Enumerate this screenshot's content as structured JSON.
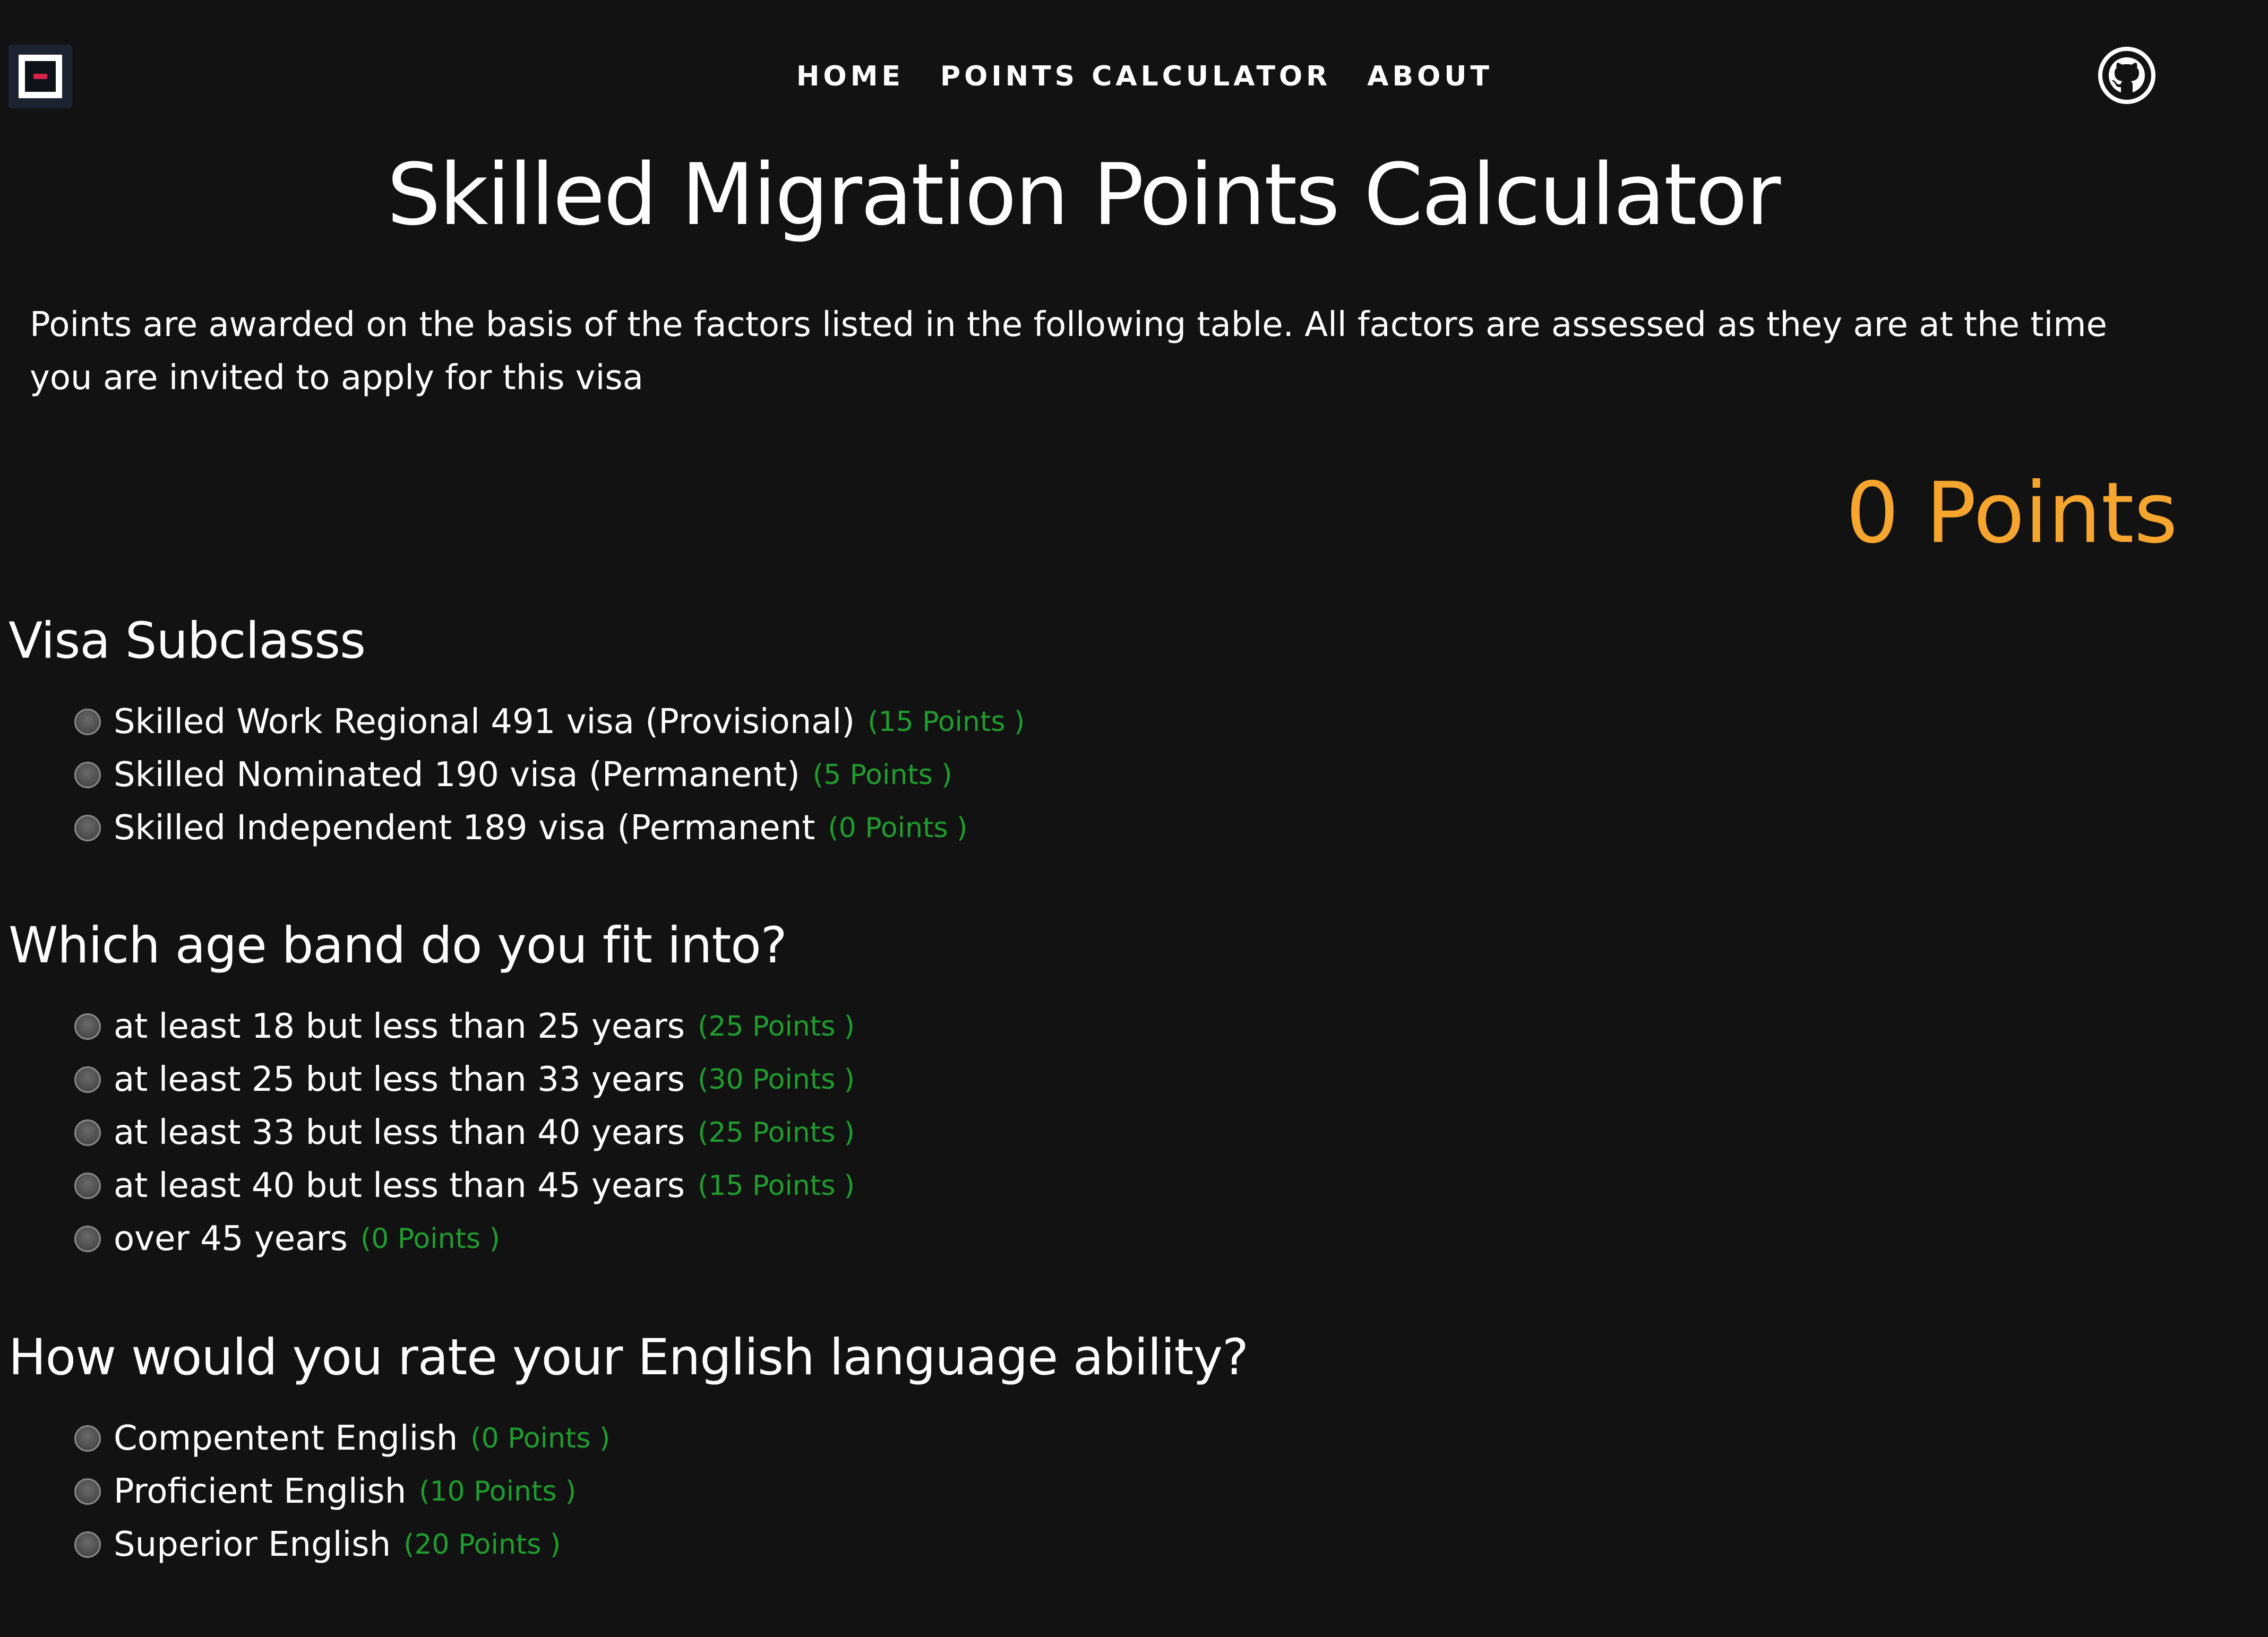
{
  "nav": {
    "home": "HOME",
    "points_calculator": "POINTS CALCULATOR",
    "about": "ABOUT"
  },
  "icons": {
    "logo": "app-logo-icon",
    "github": "github-icon"
  },
  "title": "Skilled Migration Points Calculator",
  "intro": "Points are awarded on the basis of the factors listed in the following table. All factors are assessed as they are at the time you are invited to apply for this visa",
  "total": {
    "value": "0",
    "unit": "Points"
  },
  "sections": [
    {
      "heading": "Visa Subclasss",
      "options": [
        {
          "label": "Skilled Work Regional 491 visa (Provisional)",
          "points": "(15 Points )"
        },
        {
          "label": "Skilled Nominated 190 visa (Permanent)",
          "points": "(5 Points )"
        },
        {
          "label": "Skilled Independent 189 visa (Permanent",
          "points": "(0 Points )"
        }
      ]
    },
    {
      "heading": "Which age band do you fit into?",
      "options": [
        {
          "label": "at least 18 but less than 25 years",
          "points": "(25 Points )"
        },
        {
          "label": "at least 25 but less than 33 years",
          "points": "(30 Points )"
        },
        {
          "label": "at least 33 but less than 40 years",
          "points": "(25 Points )"
        },
        {
          "label": "at least 40 but less than 45 years",
          "points": "(15 Points )"
        },
        {
          "label": "over 45 years",
          "points": "(0 Points )"
        }
      ]
    },
    {
      "heading": "How would you rate your English language ability?",
      "options": [
        {
          "label": "Compentent English",
          "points": "(0 Points )"
        },
        {
          "label": "Proficient English",
          "points": "(10 Points )"
        },
        {
          "label": "Superior English",
          "points": "(20 Points )"
        }
      ]
    }
  ],
  "colors": {
    "background": "#121212",
    "accent_total": "#f6a52e",
    "points_green": "#1f9d2e",
    "logo_red": "#d6224a"
  }
}
